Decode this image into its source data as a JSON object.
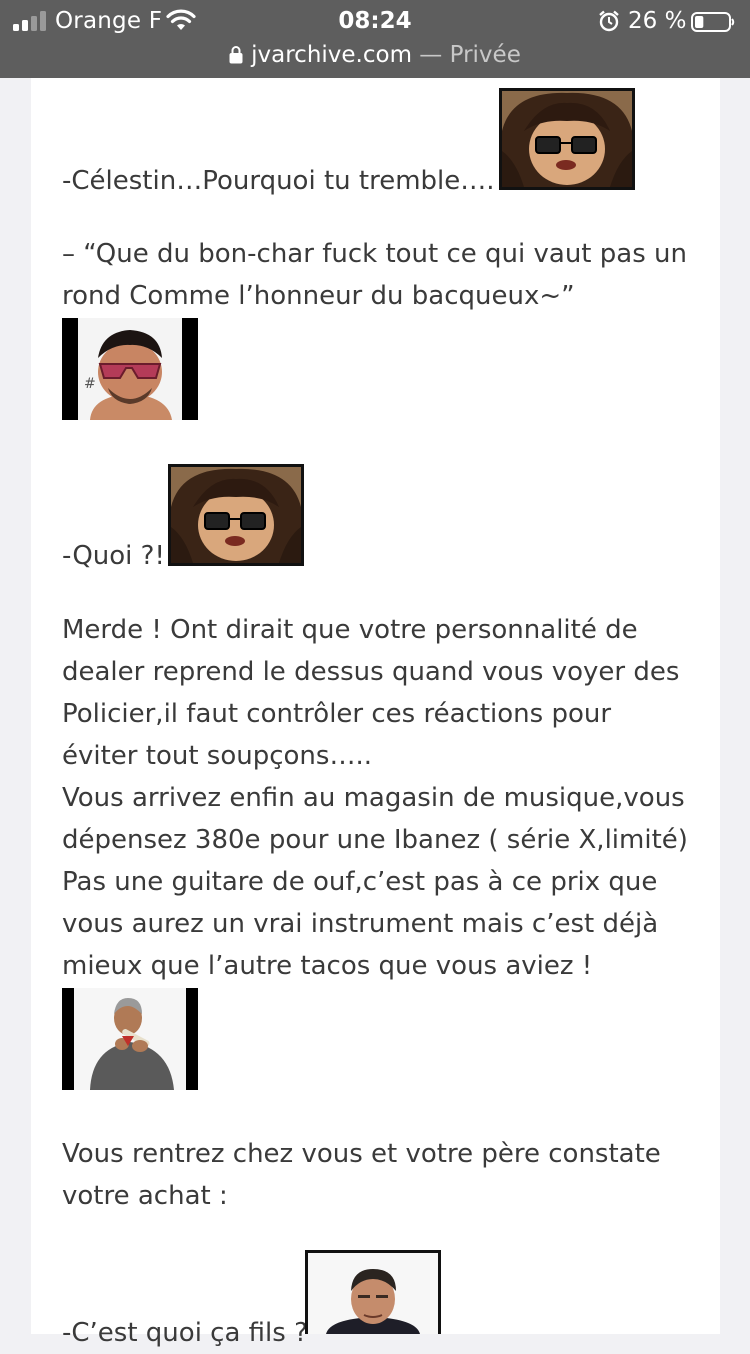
{
  "status_bar": {
    "carrier": "Orange F",
    "time": "08:24",
    "battery_percent": "26 %",
    "battery_level": 0.26,
    "icons": [
      "signal-icon",
      "wifi-icon",
      "alarm-icon",
      "battery-icon"
    ]
  },
  "url_bar": {
    "domain": "jvarchive.com",
    "separator": " — ",
    "mode": "Privée",
    "icon": "lock-icon"
  },
  "article": {
    "lines": [
      "-Célestin…Pourquoi tu tremble….",
      "– “Que du bon-char fuck tout ce qui vaut pas un",
      "rond Comme l’honneur du bacqueux~”",
      "-Quoi ?!",
      "Merde ! Ont dirait que votre personnalité de",
      "dealer reprend le dessus quand vous voyer des",
      "Policier,il faut contrôler ces réactions pour",
      "éviter tout soupçons…..",
      "Vous arrivez enfin au magasin de musique,vous",
      "dépensez 380e pour une Ibanez ( série X,limité)",
      "Pas une guitare de ouf,c’est pas à ce prix que",
      "vous aurez un vrai instrument mais c’est déjà",
      "mieux que l’autre tacos que vous aviez !",
      "Vous rentrez chez vous et votre père constate",
      "votre achat :",
      "-C’est quoi ça fils ?"
    ],
    "stickers": [
      "long-hair-glasses-sticker",
      "sunglasses-man-sticker",
      "long-hair-glasses-sticker",
      "flute-player-sticker",
      "politician-sticker"
    ]
  },
  "colors": {
    "status_bar_bg": "#5e5e5e",
    "page_bg": "#f1f1f4",
    "card_bg": "#ffffff",
    "text": "#3a3a3a"
  }
}
